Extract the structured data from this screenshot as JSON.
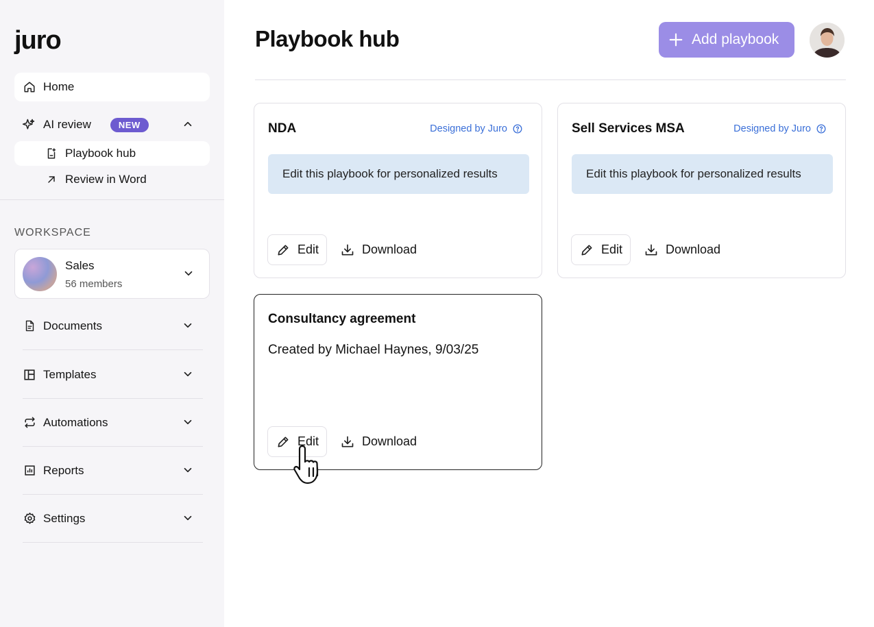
{
  "sidebar": {
    "logo": "juro",
    "home": "Home",
    "ai_review": "AI review",
    "new_badge": "NEW",
    "playbook_hub": "Playbook hub",
    "review_in_word": "Review in Word",
    "workspace_label": "WORKSPACE",
    "workspace": {
      "name": "Sales",
      "members": "56 members"
    },
    "sections": [
      {
        "label": "Documents",
        "icon": "document-icon"
      },
      {
        "label": "Templates",
        "icon": "templates-icon"
      },
      {
        "label": "Automations",
        "icon": "automations-icon"
      },
      {
        "label": "Reports",
        "icon": "reports-icon"
      },
      {
        "label": "Settings",
        "icon": "gear-icon"
      }
    ]
  },
  "header": {
    "title": "Playbook hub",
    "add_button": "Add playbook"
  },
  "cards": [
    {
      "title": "NDA",
      "designed_by": "Designed by Juro",
      "banner": "Edit this playbook for personalized results",
      "edit": "Edit",
      "download": "Download"
    },
    {
      "title": "Sell Services MSA",
      "designed_by": "Designed by Juro",
      "banner": "Edit this playbook for personalized results",
      "edit": "Edit",
      "download": "Download"
    },
    {
      "title": "Consultancy agreement",
      "created_by": "Created by Michael Haynes, 9/03/25",
      "edit": "Edit",
      "download": "Download"
    }
  ],
  "colors": {
    "accent": "#9b8de6",
    "badge": "#6d5bd0",
    "link": "#3a6fd8",
    "banner": "#dbe8f5",
    "sidebar_bg": "#f6f5f8"
  }
}
